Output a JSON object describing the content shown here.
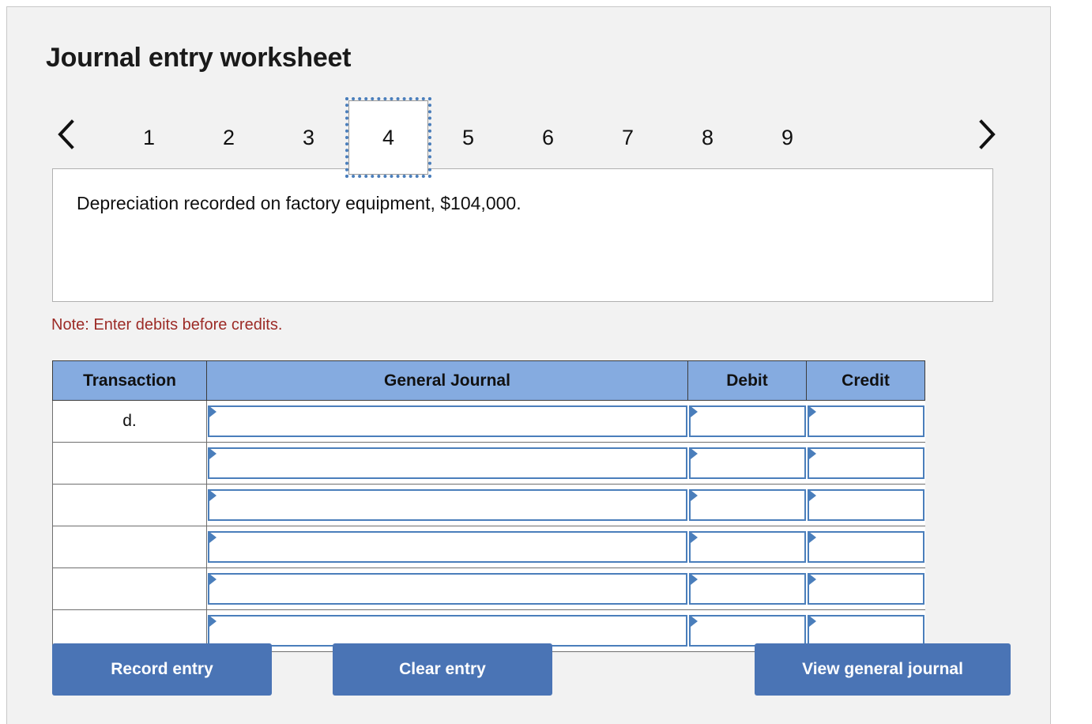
{
  "page": {
    "title": "Journal entry worksheet"
  },
  "pager": {
    "prev_icon": "chevron-left-icon",
    "next_icon": "chevron-right-icon",
    "active": "4",
    "items": [
      {
        "label": "1"
      },
      {
        "label": "2"
      },
      {
        "label": "3"
      },
      {
        "label": "4"
      },
      {
        "label": "5"
      },
      {
        "label": "6"
      },
      {
        "label": "7"
      },
      {
        "label": "8"
      },
      {
        "label": "9"
      }
    ]
  },
  "description": {
    "text": "Depreciation recorded on factory equipment, $104,000."
  },
  "note": {
    "text": "Note: Enter debits before credits."
  },
  "table": {
    "headers": {
      "transaction": "Transaction",
      "general_journal": "General Journal",
      "debit": "Debit",
      "credit": "Credit"
    },
    "rows": [
      {
        "transaction": "d.",
        "general_journal": "",
        "debit": "",
        "credit": ""
      },
      {
        "transaction": "",
        "general_journal": "",
        "debit": "",
        "credit": ""
      },
      {
        "transaction": "",
        "general_journal": "",
        "debit": "",
        "credit": ""
      },
      {
        "transaction": "",
        "general_journal": "",
        "debit": "",
        "credit": ""
      },
      {
        "transaction": "",
        "general_journal": "",
        "debit": "",
        "credit": ""
      },
      {
        "transaction": "",
        "general_journal": "",
        "debit": "",
        "credit": ""
      }
    ]
  },
  "buttons": {
    "record": "Record entry",
    "clear": "Clear entry",
    "view": "View general journal"
  },
  "colors": {
    "header_blue": "#85abe0",
    "button_blue": "#4a74b5",
    "field_blue": "#4a7ebb",
    "note_red": "#9c2b26",
    "panel_bg": "#f2f2f2"
  }
}
